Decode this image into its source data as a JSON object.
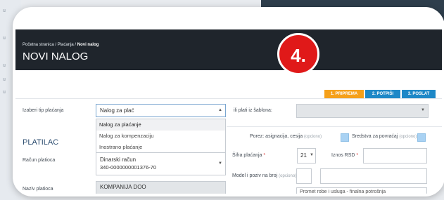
{
  "background": {
    "left_items": [
      "u",
      "u",
      "u",
      "u",
      "u"
    ]
  },
  "breadcrumb": {
    "home": "Početna stranica",
    "sep": "/",
    "payments": "Plaćanja",
    "current": "Novi nalog"
  },
  "page_title": "NOVI NALOG",
  "callout": "4.",
  "steps": [
    {
      "label": "1. PRIPREMA",
      "color": "#f5a01a"
    },
    {
      "label": "2. POTPIŠI",
      "color": "#1e88c7"
    },
    {
      "label": "3. POSLAT",
      "color": "#1e88c7"
    }
  ],
  "payment_type": {
    "label": "Izaberi tip plaćanja",
    "value": "Nalog za plać",
    "options": [
      "Nalog za plaćanje",
      "Nalog za kompenzaciju",
      "Inostrano plaćanje"
    ]
  },
  "template": {
    "label": "ili plati iz šablona:",
    "value": ""
  },
  "payer": {
    "section": "PLATILAC",
    "account_label": "Račun platioca",
    "account_name": "Dinarski račun",
    "account_number": "340-0000000001376-70",
    "name_label": "Naziv platioca",
    "name_value": "KOMPANIJA DOO"
  },
  "right": {
    "tax_label": "Porez: asignacija, cesija",
    "optional": "(opciono)",
    "refund_label": "Sredstva za povraćaj",
    "code_label": "Šifra plaćanja",
    "code_value": "21",
    "amount_label": "Iznos RSD",
    "model_label": "Model i poziv na broj",
    "purpose_value": "Promet robe i usluga - finalna potrošnja"
  },
  "required_mark": "*"
}
